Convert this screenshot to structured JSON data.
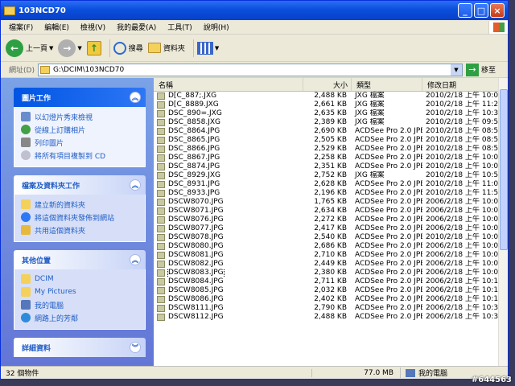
{
  "window": {
    "title": "103NCD70"
  },
  "menu": [
    "檔案(F)",
    "編輯(E)",
    "檢視(V)",
    "我的最愛(A)",
    "工具(T)",
    "說明(H)"
  ],
  "toolbar": {
    "back_label": "上一頁",
    "search_label": "搜尋",
    "folders_label": "資料夾"
  },
  "address": {
    "label": "網址(D)",
    "path": "G:\\DCIM\\103NCD70",
    "go_label": "移至"
  },
  "tasks": {
    "picture": {
      "title": "圖片工作",
      "items": [
        "以幻燈片秀來檢視",
        "從線上訂購相片",
        "列印圖片",
        "將所有項目複製到 CD"
      ]
    },
    "file": {
      "title": "檔案及資料夾工作",
      "items": [
        "建立新的資料夾",
        "將這個資料夾發佈到網站",
        "共用這個資料夾"
      ]
    },
    "other": {
      "title": "其他位置",
      "items": [
        "DCIM",
        "My Pictures",
        "我的電腦",
        "網路上的芳鄰"
      ]
    },
    "details": {
      "title": "詳細資料"
    }
  },
  "columns": {
    "name": "名稱",
    "size": "大小",
    "type": "類型",
    "date": "修改日期"
  },
  "files": [
    {
      "name": "D[C_887;.JXG",
      "size": "2,488 KB",
      "type": "JXG 檔案",
      "date": "2010/2/18 上午 10:02"
    },
    {
      "name": "D[C_8889.JXG",
      "size": "2,661 KB",
      "type": "JXG 檔案",
      "date": "2010/2/18 上午 11:20"
    },
    {
      "name": "DSC_890=.JXG",
      "size": "2,635 KB",
      "type": "JXG 檔案",
      "date": "2010/2/18 上午 10:33"
    },
    {
      "name": "DSC_8858.JXG",
      "size": "2,389 KB",
      "type": "JXG 檔案",
      "date": "2010/2/18 上午 09:53"
    },
    {
      "name": "DSC_8864.JPG",
      "size": "2,690 KB",
      "type": "ACDSee Pro 2.0 JPE...",
      "date": "2010/2/18 上午 08:54"
    },
    {
      "name": "DSC_8865.JPG",
      "size": "2,505 KB",
      "type": "ACDSee Pro 2.0 JPE...",
      "date": "2010/2/18 上午 08:54"
    },
    {
      "name": "DSC_8866.JPG",
      "size": "2,529 KB",
      "type": "ACDSee Pro 2.0 JPE...",
      "date": "2010/2/18 上午 08:54"
    },
    {
      "name": "DSC_8867.JPG",
      "size": "2,258 KB",
      "type": "ACDSee Pro 2.0 JPE...",
      "date": "2010/2/18 上午 10:00"
    },
    {
      "name": "DSC_8874.JPG",
      "size": "2,351 KB",
      "type": "ACDSee Pro 2.0 JPE...",
      "date": "2010/2/18 上午 10:02"
    },
    {
      "name": "DSC_8929.JXG",
      "size": "2,752 KB",
      "type": "JXG 檔案",
      "date": "2010/2/18 上午 10:57"
    },
    {
      "name": "DSC_8931.JPG",
      "size": "2,628 KB",
      "type": "ACDSee Pro 2.0 JPE...",
      "date": "2010/2/18 上午 11:09"
    },
    {
      "name": "DSC_8933.JPG",
      "size": "2,196 KB",
      "type": "ACDSee Pro 2.0 JPE...",
      "date": "2010/2/18 上午 11:58"
    },
    {
      "name": "DSCW8070.JPG",
      "size": "1,765 KB",
      "type": "ACDSee Pro 2.0 JPE...",
      "date": "2006/2/18 上午 10:01"
    },
    {
      "name": "DSCW8071.JPG",
      "size": "2,634 KB",
      "type": "ACDSee Pro 2.0 JPE...",
      "date": "2006/2/18 上午 10:02"
    },
    {
      "name": "DSCW8076.JPG",
      "size": "2,272 KB",
      "type": "ACDSee Pro 2.0 JPE...",
      "date": "2006/2/18 上午 10:02"
    },
    {
      "name": "DSCW8077.JPG",
      "size": "2,417 KB",
      "type": "ACDSee Pro 2.0 JPE...",
      "date": "2006/2/18 上午 10:05"
    },
    {
      "name": "DSCW8078.JPG",
      "size": "2,540 KB",
      "type": "ACDSee Pro 2.0 JPE...",
      "date": "2010/2/18 上午 10:05"
    },
    {
      "name": "DSCW8080.JPG",
      "size": "2,686 KB",
      "type": "ACDSee Pro 2.0 JPE...",
      "date": "2006/2/18 上午 10:05"
    },
    {
      "name": "DSCW8081.JPG",
      "size": "2,710 KB",
      "type": "ACDSee Pro 2.0 JPE...",
      "date": "2006/2/18 上午 10:07"
    },
    {
      "name": "DSCW8082.JPG",
      "size": "2,449 KB",
      "type": "ACDSee Pro 2.0 JPE...",
      "date": "2006/2/18 上午 10:07"
    },
    {
      "name": "DSCW8083.JPG",
      "size": "2,380 KB",
      "type": "ACDSee Pro 2.0 JPE...",
      "date": "2006/2/18 上午 10:08",
      "selected": true
    },
    {
      "name": "DSCW8084.JPG",
      "size": "2,711 KB",
      "type": "ACDSee Pro 2.0 JPE...",
      "date": "2006/2/18 上午 10:17"
    },
    {
      "name": "DSCW8085.JPG",
      "size": "2,032 KB",
      "type": "ACDSee Pro 2.0 JPE...",
      "date": "2006/2/18 上午 10:17"
    },
    {
      "name": "DSCW8086.JPG",
      "size": "2,402 KB",
      "type": "ACDSee Pro 2.0 JPE...",
      "date": "2006/2/18 上午 10:18"
    },
    {
      "name": "DSCW8111.JPG",
      "size": "2,790 KB",
      "type": "ACDSee Pro 2.0 JPE...",
      "date": "2006/2/18 上午 10:35"
    },
    {
      "name": "DSCW8112.JPG",
      "size": "2,488 KB",
      "type": "ACDSee Pro 2.0 JPE...",
      "date": "2006/2/18 上午 10:35"
    }
  ],
  "status": {
    "count": "32 個物件",
    "size": "77.0 MB",
    "location": "我的電腦"
  },
  "watermark": "#644563"
}
